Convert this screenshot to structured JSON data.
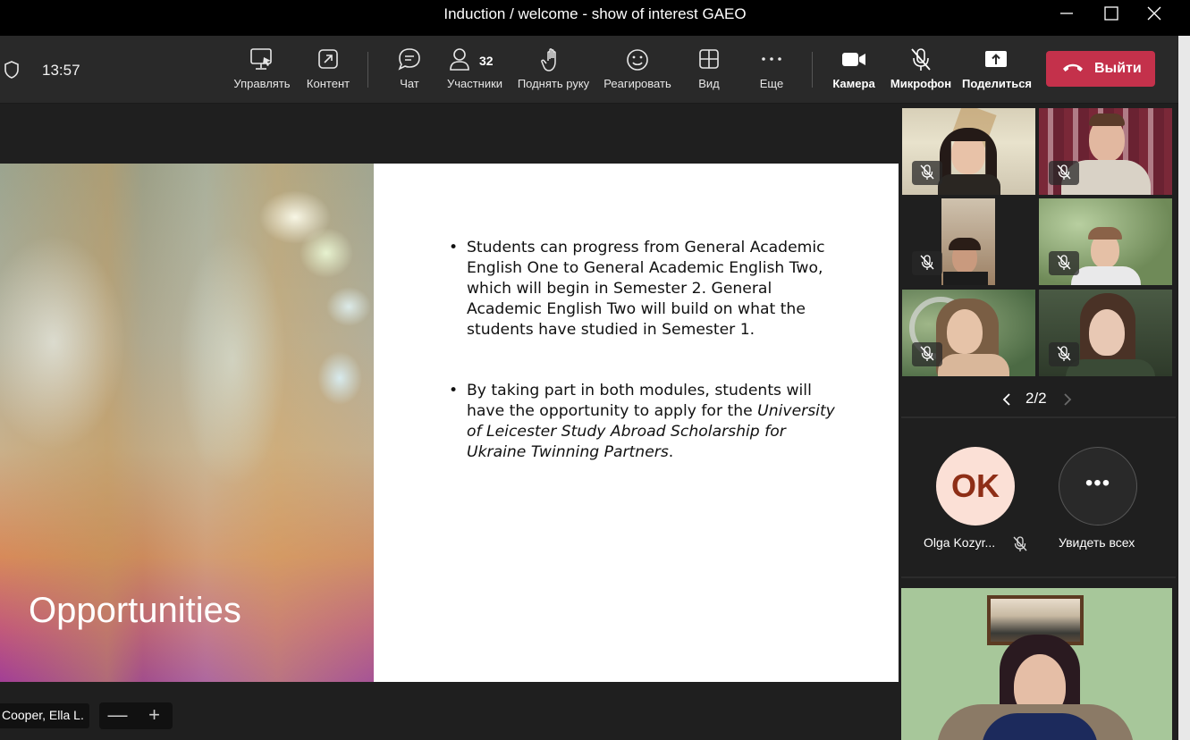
{
  "window": {
    "title": "Induction / welcome - show of interest GAEO"
  },
  "toolbar": {
    "time": "13:57",
    "manage": "Управлять",
    "content": "Контент",
    "chat": "Чат",
    "participants": "Участники",
    "participants_count": "32",
    "raise_hand": "Поднять руку",
    "react": "Реагировать",
    "view": "Вид",
    "more": "Еще",
    "camera": "Камера",
    "mic": "Микрофон",
    "share": "Поделиться",
    "leave": "Выйти",
    "leave_color": "#c4314b"
  },
  "slide": {
    "title": "Opportunities",
    "bullet1": "Students can progress from General Academic English One to General Academic English Two, which will begin in Semester 2. General Academic English Two will build on what the students have studied in Semester 1.",
    "bullet2_text": "By taking part in both modules, students will have the opportunity to apply for the",
    "bullet2_italic": "University of Leicester Study Abroad Scholarship for Ukraine Twinning Partners",
    "bullet2_end": "."
  },
  "presenter": {
    "name": "Cooper, Ella L.",
    "zoom_out": "—",
    "zoom_in": "+"
  },
  "gallery": {
    "page": "2/2",
    "tiles_muted": [
      true,
      true,
      true,
      true,
      true,
      true
    ]
  },
  "participant": {
    "initials": "OK",
    "name": "Olga Kozyr...",
    "avatar_bg": "#fbe0d6",
    "avatar_fg": "#8e2e16"
  },
  "see_all": {
    "label": "Увидеть всех"
  }
}
